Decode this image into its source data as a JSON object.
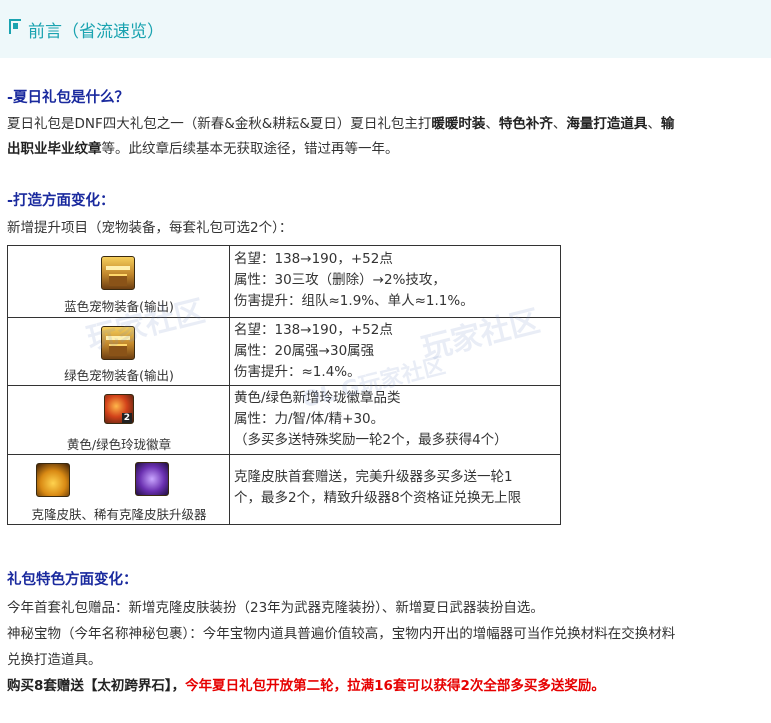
{
  "header": {
    "title": "前言（省流速览）"
  },
  "section1": {
    "title": "-夏日礼包是什么？",
    "line1_prefix": "夏日礼包是DNF四大礼包之一（新春&金秋&耕耘&夏日）夏日礼包主打",
    "line1_bold1": "暖暖时装",
    "line1_sep1": "、",
    "line1_bold2": "特色补齐",
    "line1_sep2": "、",
    "line1_bold3": "海量打造道具",
    "line1_sep3": "、",
    "line1_bold4": "输",
    "line2_bold": "出职业毕业纹章",
    "line2_rest": "等。此纹章后续基本无获取途径，错过再等一年。"
  },
  "section2": {
    "title": "-打造方面变化：",
    "intro": "新增提升项目（宠物装备，每套礼包可选2个）：",
    "rows": [
      {
        "label": "蓝色宠物装备(输出)",
        "icon": "treasure-chest-icon",
        "lines": [
          "名望：138→190，+52点",
          "属性：30三攻（删除）→2%技攻，",
          "伤害提升：组队≈1.9%、单人≈1.1%。"
        ]
      },
      {
        "label": "绿色宠物装备(输出)",
        "icon": "treasure-chest-icon",
        "lines": [
          "名望：138→190，+52点",
          "属性：20属强→30属强",
          "伤害提升：≈1.4%。"
        ]
      },
      {
        "label": "黄色/绿色玲珑徽章",
        "icon": "emblem-icon",
        "icon_badge": "2",
        "lines": [
          "黄色/绿色新增玲珑徽章品类",
          "属性：力/智/体/精+30。",
          "（多买多送特殊奖励一轮2个，最多获得4个）"
        ]
      },
      {
        "label": "克隆皮肤、稀有克隆皮肤升级器",
        "icons": [
          "clone-skin-icon",
          "rare-clone-skin-upgrader-icon"
        ],
        "lines": [
          "克隆皮肤首套赠送，完美升级器多买多送一轮1",
          "个，最多2个，精致升级器8个资格证兑换无上限"
        ]
      }
    ]
  },
  "section3": {
    "title": "礼包特色方面变化：",
    "line1": "今年首套礼包赠品：新增克隆皮肤装扮（23年为武器克隆装扮）、新增夏日武器装扮自选。",
    "line2": "神秘宝物（今年名称神秘包裹）：今年宝物内道具普遍价值较高，宝物内开出的增幅器可当作兑换材料在交换材料",
    "line3": "兑换打造道具。",
    "line4_bold": "购买8套赠送【太初跨界石】，",
    "line4_red": "今年夏日礼包开放第二轮，拉满16套可以获得2次全部多买多送奖励。"
  },
  "watermarks": [
    "玩家社区",
    "玩家社区",
    "OL G玩家社区"
  ],
  "colors": {
    "accent": "#1aa3b0",
    "section_title": "#1a2a9e",
    "highlight_red": "#e60000"
  }
}
